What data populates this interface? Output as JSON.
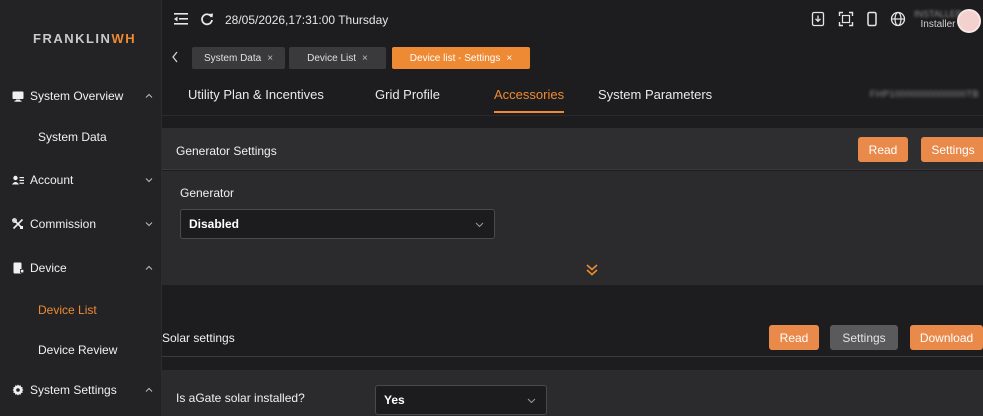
{
  "brand": {
    "logo_main": "FRANKLIN",
    "logo_accent": "WH"
  },
  "sidebar": {
    "items": [
      {
        "label": "System Overview",
        "icon": "monitor-icon"
      },
      {
        "label": "System Data"
      },
      {
        "label": "Account",
        "icon": "user-list-icon"
      },
      {
        "label": "Commission",
        "icon": "tools-icon"
      },
      {
        "label": "Device",
        "icon": "device-icon"
      },
      {
        "label": "Device List"
      },
      {
        "label": "Device Review"
      },
      {
        "label": "System Settings",
        "icon": "gear-icon"
      }
    ]
  },
  "topbar": {
    "datetime": "28/05/2026,17:31:00 Thursday",
    "user_role": "Installer",
    "user_name": "INSTALLER"
  },
  "tabs": [
    {
      "label": "System Data",
      "close": "×"
    },
    {
      "label": "Device List",
      "close": "×"
    },
    {
      "label": "Device list - Settings",
      "close": "×"
    }
  ],
  "subtabs": [
    {
      "label": "Utility Plan & Incentives"
    },
    {
      "label": "Grid Profile"
    },
    {
      "label": "Accessories"
    },
    {
      "label": "System Parameters"
    }
  ],
  "serial_number": "FHP10000000000000TB",
  "generator_settings": {
    "title": "Generator Settings",
    "read_label": "Read",
    "settings_label": "Settings",
    "field_label": "Generator",
    "field_value": "Disabled"
  },
  "solar_settings": {
    "title": "Solar settings",
    "read_label": "Read",
    "settings_label": "Settings",
    "download_label": "Download",
    "question": "Is aGate solar installed?",
    "answer": "Yes"
  },
  "colors": {
    "accent": "#ee8a33",
    "button_orange": "#e9894a",
    "button_gray": "#5a5a5c",
    "background": "#1d1d1f"
  }
}
